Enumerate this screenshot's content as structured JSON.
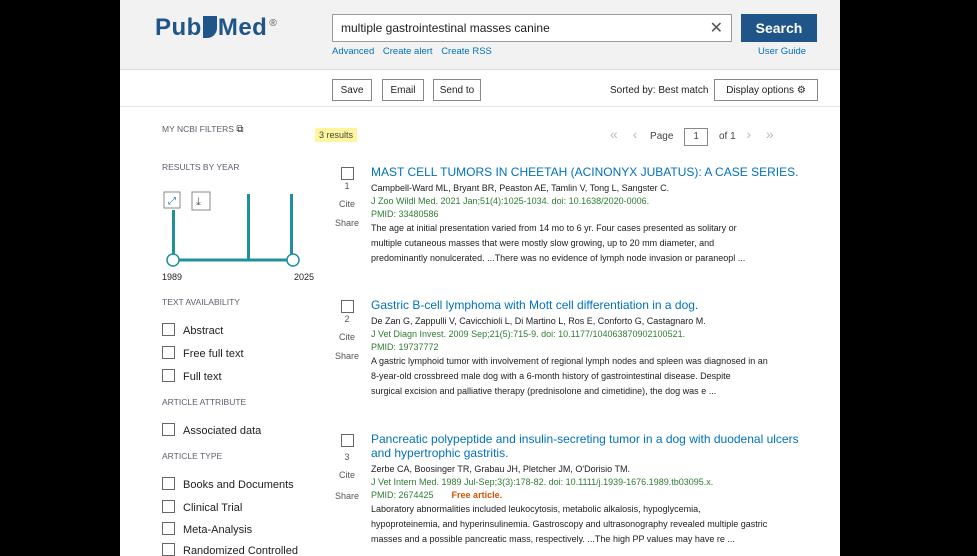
{
  "logo": {
    "text1": "Pub",
    "text2": "Med",
    "reg": "®"
  },
  "search": {
    "query": "multiple gastrointestinal masses canine",
    "button": "Search"
  },
  "links": {
    "advanced": "Advanced",
    "create_alert": "Create alert",
    "create_rss": "Create RSS",
    "user_guide": "User Guide"
  },
  "toolbar": {
    "save": "Save",
    "email": "Email",
    "send_to": "Send to",
    "sorted": "Sorted by: Best match",
    "display": "Display options"
  },
  "sidebar": {
    "my_filters": "MY NCBI FILTERS",
    "by_year": "RESULTS BY YEAR",
    "year_start": "1989",
    "year_end": "2025",
    "text_avail": "TEXT AVAILABILITY",
    "text_items": [
      "Abstract",
      "Free full text",
      "Full text"
    ],
    "article_attr": "ARTICLE ATTRIBUTE",
    "attr_items": [
      "Associated data"
    ],
    "article_type": "ARTICLE TYPE",
    "type_items": [
      "Books and Documents",
      "Clinical Trial",
      "Meta-Analysis",
      "Randomized Controlled"
    ]
  },
  "results_count": "3 results",
  "pager": {
    "page_label": "Page",
    "page": "1",
    "of": "of 1"
  },
  "results": [
    {
      "num": "1",
      "cite": "Cite",
      "share": "Share",
      "title": "MAST CELL TUMORS IN CHEETAH (ACINONYX JUBATUS): A CASE SERIES.",
      "authors": "Campbell-Ward ML, Bryant BR, Peaston AE, Tamlin V, Tong L, Sangster C.",
      "journal": "J Zoo Wildl Med. 2021 Jan;51(4):1025-1034. doi: 10.1638/2020-0006.",
      "pmid": "PMID: 33480586",
      "free": "",
      "snippet": [
        "The age at initial presentation varied from 14 mo to 6 yr. Four cases presented as solitary or",
        "multiple cutaneous masses that were mostly slow growing, up to 20 mm diameter, and",
        "predominantly nonulcerated. ...There was no evidence of lymph node invasion or paraneopl ..."
      ]
    },
    {
      "num": "2",
      "cite": "Cite",
      "share": "Share",
      "title": "Gastric B-cell lymphoma with Mott cell differentiation in a dog.",
      "authors": "De Zan G, Zappulli V, Cavicchioli L, Di Martino L, Ros E, Conforto G, Castagnaro M.",
      "journal": "J Vet Diagn Invest. 2009 Sep;21(5):715-9. doi: 10.1177/104063870902100521.",
      "pmid": "PMID: 19737772",
      "free": "",
      "snippet": [
        "A gastric lymphoid tumor with involvement of regional lymph nodes and spleen was diagnosed in an",
        "8-year-old crossbreed male dog with a 6-month history of gastrointestinal disease. Despite",
        "surgical excision and palliative therapy (prednisolone and cimetidine), the dog was e ..."
      ]
    },
    {
      "num": "3",
      "cite": "Cite",
      "share": "Share",
      "title": "Pancreatic polypeptide and insulin-secreting tumor in a dog with duodenal ulcers and hypertrophic gastritis.",
      "authors": "Zerbe CA, Boosinger TR, Grabau JH, Pletcher JM, O'Dorisio TM.",
      "journal": "J Vet Intern Med. 1989 Jul-Sep;3(3):178-82. doi: 10.1111/j.1939-1676.1989.tb03095.x.",
      "pmid": "PMID: 2674425",
      "free": "Free article.",
      "snippet": [
        "Laboratory abnormalities included leukocytosis, metabolic alkalosis, hypoglycemia,",
        "hypoproteinemia, and hyperinsulinemia. Gastroscopy and ultrasonography revealed multiple gastric",
        "masses and a possible pancreatic mass, respectively. ...The high PP values may have re ..."
      ]
    }
  ]
}
